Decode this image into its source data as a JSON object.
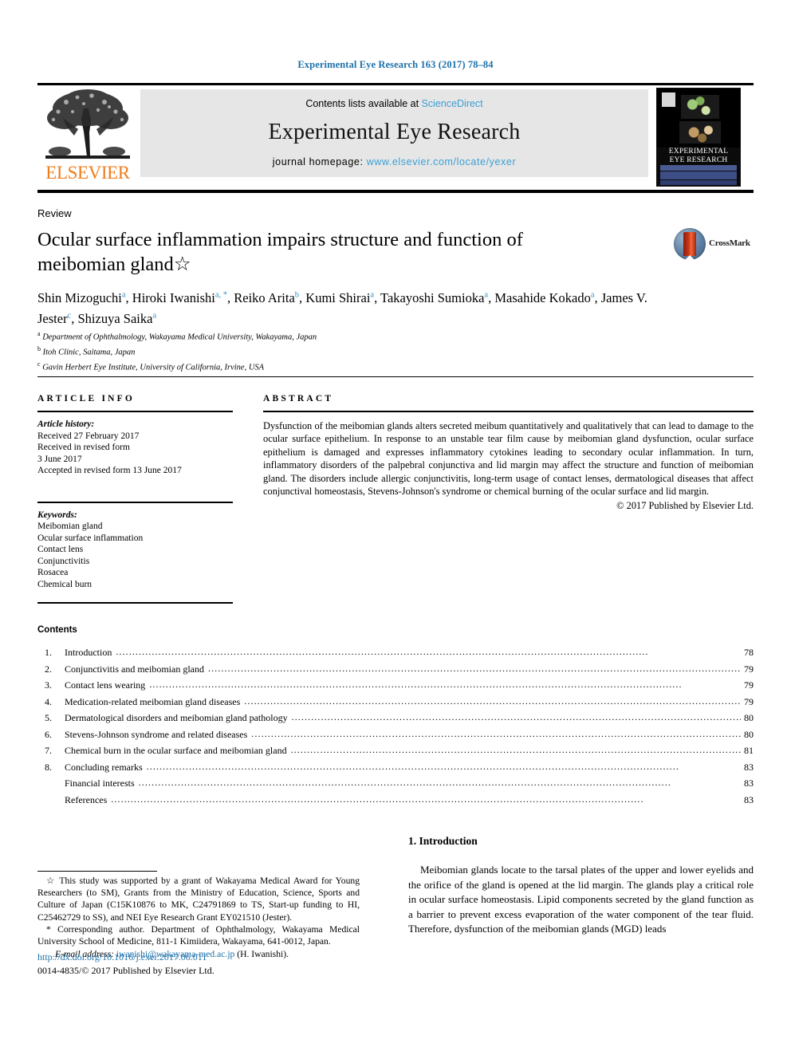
{
  "running_head": "Experimental Eye Research 163 (2017) 78–84",
  "masthead": {
    "contents_prefix": "Contents lists available at ",
    "sciencedirect": "ScienceDirect",
    "journal_title": "Experimental Eye Research",
    "homepage_prefix": "journal homepage: ",
    "homepage_url": "www.elsevier.com/locate/yexer",
    "publisher_logo_text": "ELSEVIER",
    "cover_title_line1": "EXPERIMENTAL",
    "cover_title_line2": "EYE RESEARCH",
    "link_color": "#3a9fd4",
    "band_color": "#e6e6e6",
    "elsevier_orange": "#f07c1a"
  },
  "article": {
    "type_label": "Review",
    "title": "Ocular surface inflammation impairs structure and function of meibomian gland",
    "title_footnote_mark": "☆",
    "crossmark_label": "CrossMark",
    "authors": [
      {
        "name": "Shin Mizoguchi",
        "marks": "a",
        "sep": ", "
      },
      {
        "name": "Hiroki Iwanishi",
        "marks": "a, *",
        "sep": ", "
      },
      {
        "name": "Reiko Arita",
        "marks": "b",
        "sep": ", "
      },
      {
        "name": "Kumi Shirai",
        "marks": "a",
        "sep": ", "
      },
      {
        "name": "Takayoshi Sumioka",
        "marks": "a",
        "sep": ", "
      },
      {
        "name": "Masahide Kokado",
        "marks": "a",
        "sep": ", "
      },
      {
        "name": "James V. Jester",
        "marks": "c",
        "sep": ", "
      },
      {
        "name": "Shizuya Saika",
        "marks": "a",
        "sep": ""
      }
    ],
    "affiliations": [
      {
        "mark": "a",
        "text": "Department of Ophthalmology, Wakayama Medical University, Wakayama, Japan"
      },
      {
        "mark": "b",
        "text": "Itoh Clinic, Saitama, Japan"
      },
      {
        "mark": "c",
        "text": "Gavin Herbert Eye Institute, University of California, Irvine, USA"
      }
    ]
  },
  "article_info": {
    "heading": "ARTICLE INFO",
    "history_label": "Article history:",
    "history_lines": [
      "Received 27 February 2017",
      "Received in revised form",
      "3 June 2017",
      "Accepted in revised form 13 June 2017"
    ],
    "keywords_label": "Keywords:",
    "keywords": [
      "Meibomian gland",
      "Ocular surface inflammation",
      "Contact lens",
      "Conjunctivitis",
      "Rosacea",
      "Chemical burn"
    ]
  },
  "abstract": {
    "heading": "ABSTRACT",
    "body": "Dysfunction of the meibomian glands alters secreted meibum quantitatively and qualitatively that can lead to damage to the ocular surface epithelium. In response to an unstable tear film cause by meibomian gland dysfunction, ocular surface epithelium is damaged and expresses inflammatory cytokines leading to secondary ocular inflammation. In turn, inflammatory disorders of the palpebral conjunctiva and lid margin may affect the structure and function of meibomian gland. The disorders include allergic conjunctivitis, long-term usage of contact lenses, dermatological diseases that affect conjunctival homeostasis, Stevens-Johnson's syndrome or chemical burning of the ocular surface and lid margin.",
    "copyright": "© 2017 Published by Elsevier Ltd."
  },
  "contents": {
    "heading": "Contents",
    "items": [
      {
        "num": "1.",
        "label": "Introduction",
        "page": "78"
      },
      {
        "num": "2.",
        "label": "Conjunctivitis and meibomian gland",
        "page": "79"
      },
      {
        "num": "3.",
        "label": "Contact lens wearing",
        "page": "79"
      },
      {
        "num": "4.",
        "label": "Medication-related meibomian gland diseases",
        "page": "79"
      },
      {
        "num": "5.",
        "label": "Dermatological disorders and meibomian gland pathology",
        "page": "80"
      },
      {
        "num": "6.",
        "label": "Stevens-Johnson syndrome and related diseases",
        "page": "80"
      },
      {
        "num": "7.",
        "label": "Chemical burn in the ocular surface and meibomian gland",
        "page": "81"
      },
      {
        "num": "8.",
        "label": "Concluding remarks",
        "page": "83"
      },
      {
        "num": "",
        "label": "Financial interests",
        "page": "83"
      },
      {
        "num": "",
        "label": "References",
        "page": "83"
      }
    ]
  },
  "footnotes": {
    "funding": "☆ This study was supported by a grant of Wakayama Medical Award for Young Researchers (to SM), Grants from the Ministry of Education, Science, Sports and Culture of Japan (C15K10876 to MK, C24791869 to TS, Start-up funding to HI, C25462729 to SS), and NEI Eye Research Grant EY021510 (Jester).",
    "corresponding": "* Corresponding author. Department of Ophthalmology, Wakayama Medical University School of Medicine, 811-1 Kimiidera, Wakayama, 641-0012, Japan.",
    "email_label": "E-mail address:",
    "email": "iwanishi@wakayama-med.ac.jp",
    "email_suffix": "(H. Iwanishi).",
    "doi": "http://dx.doi.org/10.1016/j.exer.2017.06.011",
    "issn_copyright": "0014-4835/© 2017 Published by Elsevier Ltd."
  },
  "introduction": {
    "heading": "1. Introduction",
    "body": "Meibomian glands locate to the tarsal plates of the upper and lower eyelids and the orifice of the gland is opened at the lid margin. The glands play a critical role in ocular surface homeostasis. Lipid components secreted by the gland function as a barrier to prevent excess evaporation of the water component of the tear fluid. Therefore, dysfunction of the meibomian glands (MGD) leads"
  }
}
